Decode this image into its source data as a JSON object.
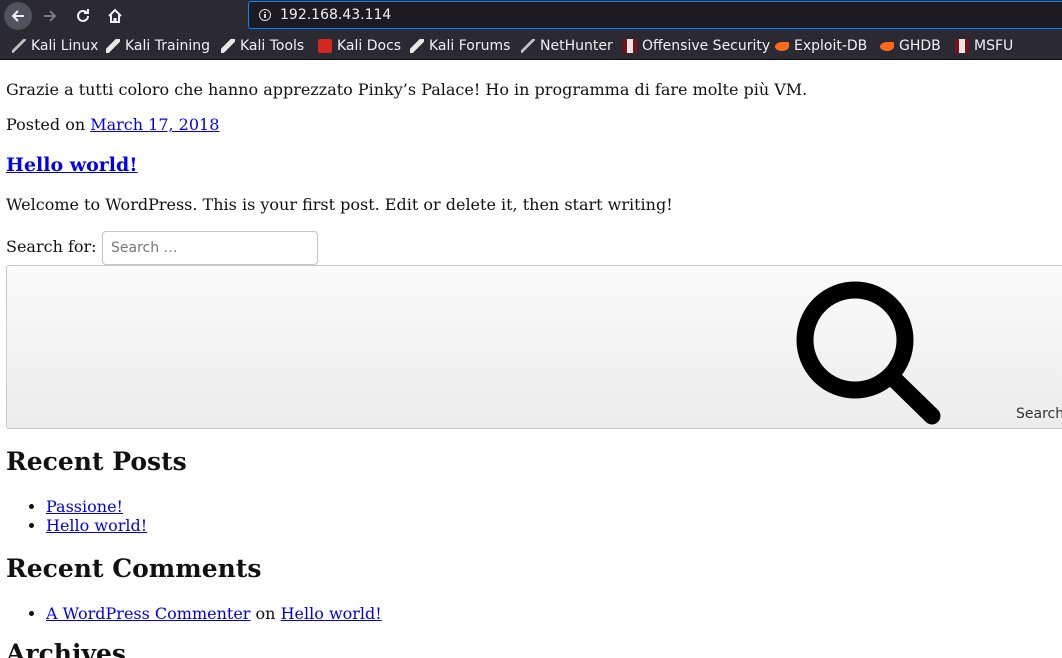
{
  "browser": {
    "url": "192.168.43.114",
    "bookmarks": [
      {
        "label": "Kali Linux",
        "icon": "kali-icon"
      },
      {
        "label": "Kali Training",
        "icon": "kali-dragon-icon"
      },
      {
        "label": "Kali Tools",
        "icon": "kali-dragon-icon"
      },
      {
        "label": "Kali Docs",
        "icon": "kali-docs-icon"
      },
      {
        "label": "Kali Forums",
        "icon": "kali-dragon-icon"
      },
      {
        "label": "NetHunter",
        "icon": "kali-icon"
      },
      {
        "label": "Offensive Security",
        "icon": "offsec-icon"
      },
      {
        "label": "Exploit-DB",
        "icon": "exploit-db-icon"
      },
      {
        "label": "GHDB",
        "icon": "exploit-db-icon"
      },
      {
        "label": "MSFU",
        "icon": "offsec-icon"
      }
    ]
  },
  "content": {
    "post_text": "Grazie a tutti coloro che hanno apprezzato Pinky’s Palace! Ho in programma di fare molte più VM.",
    "posted_on_label": "Posted on",
    "posted_on_date": "March 17, 2018",
    "post2_title": "Hello world!",
    "post2_text": "Welcome to WordPress. This is your first post. Edit or delete it, then start writing!"
  },
  "search": {
    "label": "Search for:",
    "placeholder": "Search …",
    "button_label": "Search",
    "icon": "search-icon"
  },
  "recent_posts": {
    "title": "Recent Posts",
    "items": [
      "Passione!",
      "Hello world!"
    ]
  },
  "recent_comments": {
    "title": "Recent Comments",
    "author": "A WordPress Commenter",
    "on": "on",
    "post": "Hello world!"
  },
  "archives": {
    "title": "Archives"
  }
}
